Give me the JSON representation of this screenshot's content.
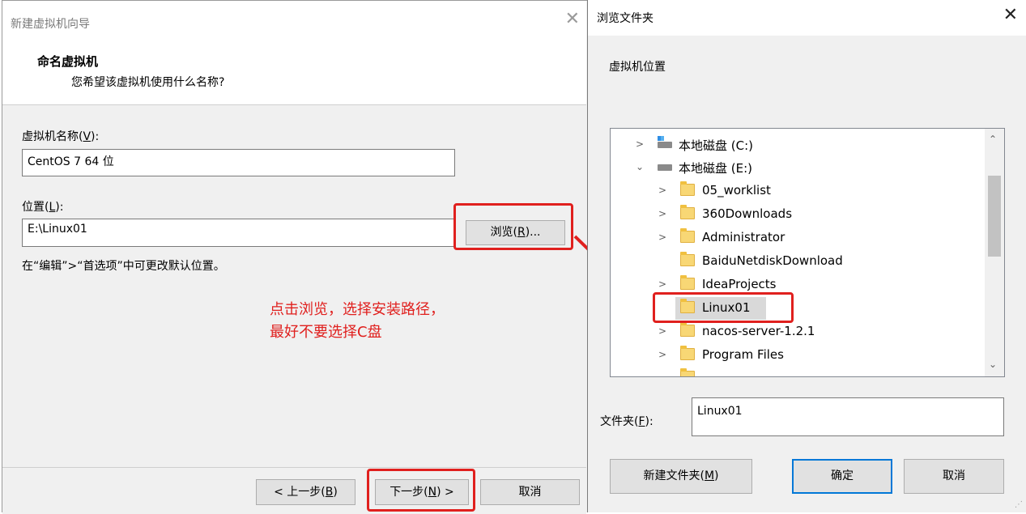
{
  "wizard": {
    "title": "新建虚拟机向导",
    "header_title": "命名虚拟机",
    "header_subtitle": "您希望该虚拟机使用什么名称?",
    "name_label_prefix": "虚拟机名称(",
    "name_label_key": "V",
    "name_label_suffix": "):",
    "name_value": "CentOS 7 64 位",
    "location_label_prefix": "位置(",
    "location_label_key": "L",
    "location_label_suffix": "):",
    "location_value": "E:\\Linux01",
    "browse_prefix": "浏览(",
    "browse_key": "R",
    "browse_suffix": ")...",
    "hint": "在“编辑”>“首选项”中可更改默认位置。",
    "back_prefix": "< 上一步(",
    "back_key": "B",
    "back_suffix": ")",
    "next_prefix": "下一步(",
    "next_key": "N",
    "next_suffix": ") >",
    "cancel_label": "取消"
  },
  "annotation": {
    "line1": "点击浏览，选择安装路径，",
    "line2": "最好不要选择C盘"
  },
  "browse_dialog": {
    "title": "浏览文件夹",
    "description": "虚拟机位置",
    "tree": [
      {
        "label": "本地磁盘 (C:)",
        "kind": "drive-c",
        "expand": "collapsed"
      },
      {
        "label": "本地磁盘 (E:)",
        "kind": "drive",
        "expand": "expanded"
      },
      {
        "label": "05_worklist",
        "kind": "folder",
        "expand": "collapsed"
      },
      {
        "label": "360Downloads",
        "kind": "folder",
        "expand": "collapsed"
      },
      {
        "label": "Administrator",
        "kind": "folder",
        "expand": "collapsed"
      },
      {
        "label": "BaiduNetdiskDownload",
        "kind": "folder",
        "expand": "none"
      },
      {
        "label": "IdeaProjects",
        "kind": "folder",
        "expand": "collapsed"
      },
      {
        "label": "Linux01",
        "kind": "folder",
        "expand": "none",
        "selected": true
      },
      {
        "label": "nacos-server-1.2.1",
        "kind": "folder",
        "expand": "collapsed"
      },
      {
        "label": "Program Files",
        "kind": "folder",
        "expand": "collapsed"
      }
    ],
    "folder_label_prefix": "文件夹(",
    "folder_label_key": "F",
    "folder_label_suffix": "):",
    "folder_value": "Linux01",
    "new_folder_prefix": "新建文件夹(",
    "new_folder_key": "M",
    "new_folder_suffix": ")",
    "ok_label": "确定",
    "cancel_label": "取消"
  },
  "colors": {
    "highlight_red": "#e0201e",
    "ok_border": "#0078d7",
    "folder_yellow": "#f8d775"
  }
}
